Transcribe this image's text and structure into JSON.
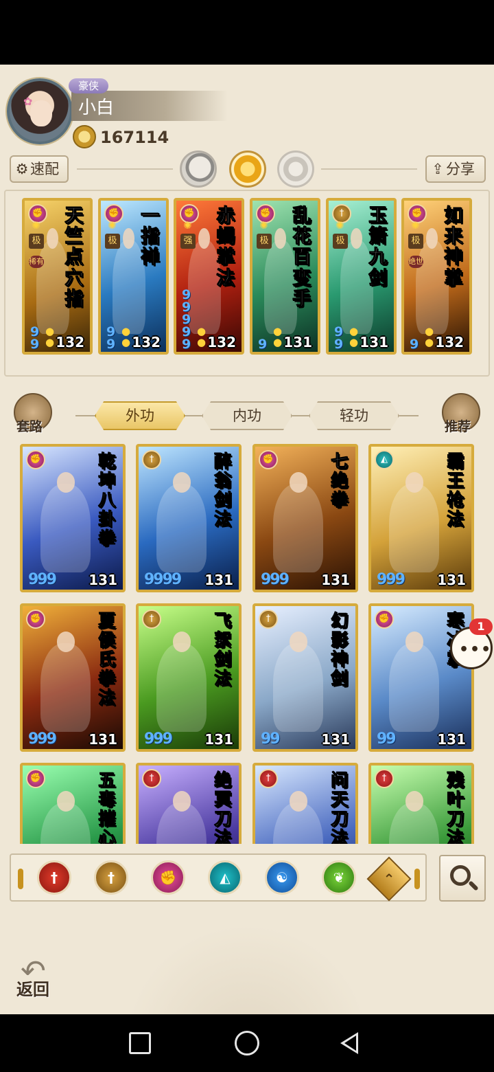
{
  "player": {
    "rank": "豪侠",
    "name": "小白",
    "coins": "167114"
  },
  "toolbar": {
    "speed_label": "速配",
    "share_label": "分享",
    "modes": [
      "moon",
      "sun",
      "ring"
    ],
    "active_mode": "sun"
  },
  "deck": [
    {
      "name": "天竺点穴指",
      "level": "132",
      "type": "pink",
      "tag": "极",
      "tag2": "稀有",
      "spirals": "99"
    },
    {
      "name": "一指禅",
      "level": "132",
      "type": "pink",
      "tag": "极",
      "tag2": "",
      "spirals": "99"
    },
    {
      "name": "赤蝎掌法",
      "level": "132",
      "type": "pink",
      "tag": "强",
      "tag2": "",
      "spirals": "99999"
    },
    {
      "name": "乱花百变手",
      "level": "131",
      "type": "pink",
      "tag": "极",
      "tag2": "",
      "spirals": "9"
    },
    {
      "name": "玉箫九剑",
      "level": "131",
      "type": "gold",
      "tag": "极",
      "tag2": "",
      "spirals": "99"
    },
    {
      "name": "如来神掌",
      "level": "132",
      "type": "pink",
      "tag": "极",
      "tag2": "绝世",
      "spirals": "9"
    }
  ],
  "side": {
    "left_label": "套路",
    "right_label": "推荐"
  },
  "tabs": [
    {
      "label": "外功",
      "active": true
    },
    {
      "label": "内功",
      "active": false
    },
    {
      "label": "轻功",
      "active": false
    }
  ],
  "cards": [
    {
      "name": "乾坤八卦拳",
      "level": "131",
      "type": "pink",
      "spirals": "999"
    },
    {
      "name": "醉翁剑法",
      "level": "131",
      "type": "gold",
      "spirals": "9999"
    },
    {
      "name": "七绝拳",
      "level": "131",
      "type": "pink",
      "spirals": "999"
    },
    {
      "name": "霸王枪法",
      "level": "131",
      "type": "teal",
      "spirals": "999"
    },
    {
      "name": "夏侯氏拳法",
      "level": "131",
      "type": "pink",
      "spirals": "999"
    },
    {
      "name": "飞絮剑法",
      "level": "131",
      "type": "gold",
      "spirals": "999"
    },
    {
      "name": "幻影神剑",
      "level": "131",
      "type": "gold",
      "spirals": "99"
    },
    {
      "name": "寒冰掌",
      "level": "131",
      "type": "pink",
      "spirals": "99"
    },
    {
      "name": "五毒摧心",
      "level": "",
      "type": "pink",
      "spirals": ""
    },
    {
      "name": "绝冥刀法",
      "level": "",
      "type": "red",
      "spirals": ""
    },
    {
      "name": "问天刀法",
      "level": "",
      "type": "red",
      "spirals": ""
    },
    {
      "name": "残叶刀法",
      "level": "",
      "type": "red",
      "spirals": ""
    }
  ],
  "chat": {
    "badge": "1"
  },
  "filters": [
    "sword-red-icon",
    "sword-gold-icon",
    "fist-pink-icon",
    "fan-teal-icon",
    "spiral-blue-icon",
    "leaf-green-icon",
    "rank-up-icon"
  ],
  "back_label": "返回",
  "colors": {
    "gold_frame": "#d6ab3c",
    "background": "#efe7d6",
    "active_tab": "#e9c666"
  }
}
